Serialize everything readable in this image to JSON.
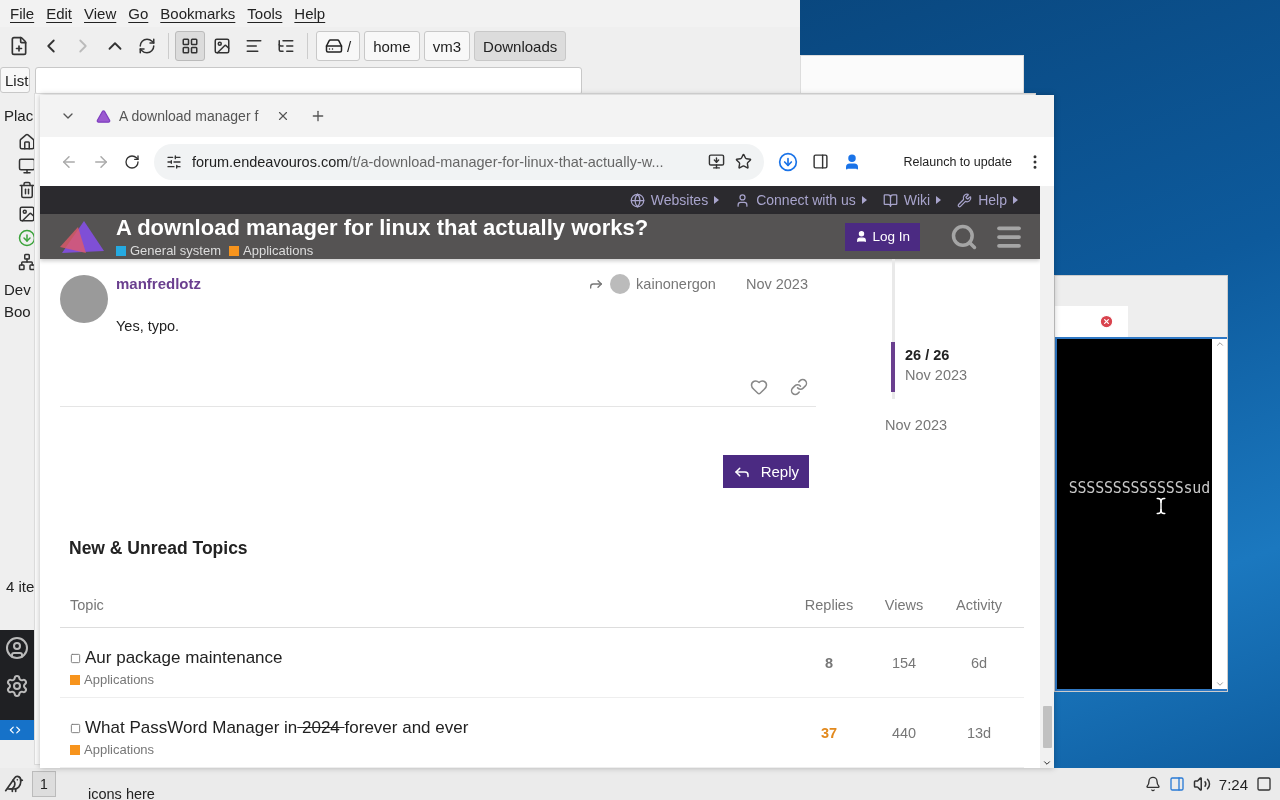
{
  "file_manager": {
    "menu": [
      "File",
      "Edit",
      "View",
      "Go",
      "Bookmarks",
      "Tools",
      "Help"
    ],
    "view_modes": [
      {
        "selected": true
      },
      {
        "selected": false
      },
      {
        "selected": false
      },
      {
        "selected": false
      }
    ],
    "breadcrumb": [
      {
        "label": "/",
        "selected": false
      },
      {
        "label": "home",
        "selected": false
      },
      {
        "label": "vm3",
        "selected": false
      },
      {
        "label": "Downloads",
        "selected": true
      }
    ],
    "view_dropdown": "List",
    "places_heading": "Plac",
    "sections": [
      "Dev",
      "Boo"
    ],
    "status": "4 ite"
  },
  "browser": {
    "tab": {
      "title": "A download manager f"
    },
    "address": {
      "host": "forum.endeavouros.com",
      "path": "/t/a-download-manager-for-linux-that-actually-w..."
    },
    "relaunch": "Relaunch to update",
    "site": {
      "nav": [
        "Websites",
        "Connect with us",
        "Wiki",
        "Help"
      ],
      "topic": {
        "title": "A download manager for linux that actually works?",
        "categories": [
          {
            "name": "General system",
            "color": "#25aae1"
          },
          {
            "name": "Applications",
            "color": "#f7941d"
          }
        ]
      },
      "login": "Log In",
      "post": {
        "author": "manfredlotz",
        "reply_to": "kainonergon",
        "date": "Nov 2023",
        "body": "Yes, typo."
      },
      "timeline": {
        "position": "26 / 26",
        "date": "Nov 2023",
        "end_date": "Nov 2023"
      },
      "reply": "Reply",
      "suggested": {
        "heading": "New & Unread Topics",
        "columns": [
          "Topic",
          "Replies",
          "Views",
          "Activity"
        ],
        "rows": [
          {
            "title": [
              {
                "text": "Aur package maintenance",
                "struck": false
              }
            ],
            "category": "Applications",
            "color": "#f7941d",
            "replies": "8",
            "hot": false,
            "views": "154",
            "activity": "6d"
          },
          {
            "title": [
              {
                "text": "What PassWord Manager in",
                "struck": false
              },
              {
                "text": " 2024 ",
                "struck": true
              },
              {
                "text": "forever and ever",
                "struck": false
              }
            ],
            "category": "Applications",
            "color": "#f7941d",
            "replies": "37",
            "hot": true,
            "views": "440",
            "activity": "13d"
          }
        ]
      }
    }
  },
  "terminal": {
    "line": "SSSSSSSSSSSSSsud"
  },
  "taskbar": {
    "workspace": "1",
    "tray_label": "icons here",
    "clock": "7:24"
  }
}
